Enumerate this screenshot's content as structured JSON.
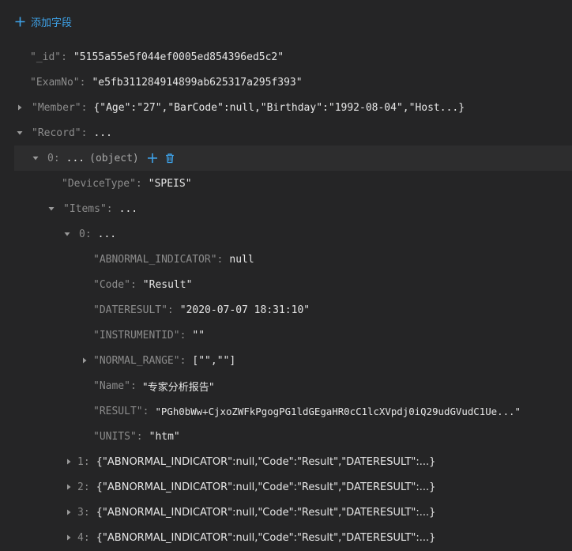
{
  "toolbar": {
    "add_field_label": "添加字段"
  },
  "colors": {
    "accent": "#3ea2e8",
    "background": "#252526",
    "selected_row": "#2d2d2e",
    "key": "#8c8c8c",
    "value": "#e6e6e6"
  },
  "rows": {
    "id": {
      "key": "\"_id\"",
      "value": "\"5155a55e5f044ef0005ed854396ed5c2\""
    },
    "examno": {
      "key": "\"ExamNo\"",
      "value": "\"e5fb311284914899ab625317a295f393\""
    },
    "member": {
      "key": "\"Member\"",
      "value": "{\"Age\":\"27\",\"BarCode\":null,\"Birthday\":\"1992-08-04\",\"Host...}"
    },
    "record": {
      "key": "\"Record\"",
      "value": "..."
    },
    "record_0": {
      "key": "0",
      "value": "...",
      "type": "(object)"
    },
    "devicetype": {
      "key": "\"DeviceType\"",
      "value": "\"SPEIS\""
    },
    "items": {
      "key": "\"Items\"",
      "value": "..."
    },
    "items_0": {
      "key": "0",
      "value": "..."
    },
    "abnormal": {
      "key": "\"ABNORMAL_INDICATOR\"",
      "value": "null"
    },
    "code": {
      "key": "\"Code\"",
      "value": "\"Result\""
    },
    "dateresult": {
      "key": "\"DATERESULT\"",
      "value": "\"2020-07-07 18:31:10\""
    },
    "instrumentid": {
      "key": "\"INSTRUMENTID\"",
      "value": "\"\""
    },
    "normal_range": {
      "key": "\"NORMAL_RANGE\"",
      "value": "[\"\",\"\"]"
    },
    "name": {
      "key": "\"Name\"",
      "value": "\"专家分析报告\""
    },
    "result": {
      "key": "\"RESULT\"",
      "value": "\"PGh0bWw+CjxoZWFkPgogPG1ldGEgaHR0cC1lcXVpdj0iQ29udGVudC1Ue...\""
    },
    "units": {
      "key": "\"UNITS\"",
      "value": "\"htm\""
    },
    "items_1": {
      "key": "1",
      "value": "{\"ABNORMAL_INDICATOR\":null,\"Code\":\"Result\",\"DATERESULT\":...}"
    },
    "items_2": {
      "key": "2",
      "value": "{\"ABNORMAL_INDICATOR\":null,\"Code\":\"Result\",\"DATERESULT\":...}"
    },
    "items_3": {
      "key": "3",
      "value": "{\"ABNORMAL_INDICATOR\":null,\"Code\":\"Result\",\"DATERESULT\":...}"
    },
    "items_4": {
      "key": "4",
      "value": "{\"ABNORMAL_INDICATOR\":null,\"Code\":\"Result\",\"DATERESULT\":...}"
    }
  }
}
